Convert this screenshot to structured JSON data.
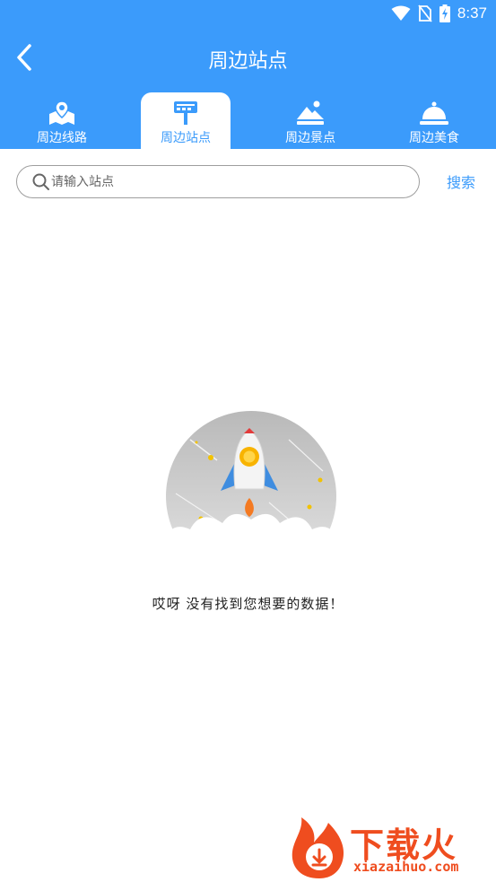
{
  "status_bar": {
    "time": "8:37"
  },
  "header": {
    "title": "周边站点"
  },
  "tabs": [
    {
      "label": "周边线路",
      "icon": "map-route-icon",
      "active": false
    },
    {
      "label": "周边站点",
      "icon": "bus-stop-sign-icon",
      "active": true
    },
    {
      "label": "周边景点",
      "icon": "scenery-icon",
      "active": false
    },
    {
      "label": "周边美食",
      "icon": "food-cloche-icon",
      "active": false
    }
  ],
  "search": {
    "placeholder": "请输入站点",
    "value": "",
    "button_label": "搜索"
  },
  "empty_state": {
    "message": "哎呀 没有找到您想要的数据！",
    "illustration": "rocket-illustration"
  },
  "watermark": {
    "logo": "下载火",
    "url": "xiazaihuo.com"
  },
  "colors": {
    "primary": "#3b9bfb",
    "watermark": "#ef4d1f"
  }
}
